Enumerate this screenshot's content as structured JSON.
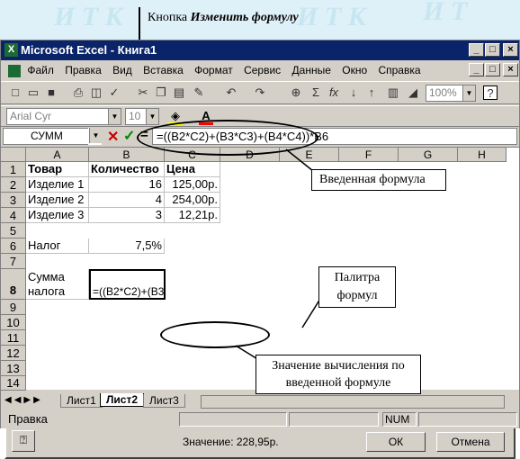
{
  "annotation_top": {
    "prefix": "Кнопка ",
    "bold": "Изменить формулу"
  },
  "window": {
    "title": "Microsoft Excel - Книга1"
  },
  "menu": [
    "Файл",
    "Правка",
    "Вид",
    "Вставка",
    "Формат",
    "Сервис",
    "Данные",
    "Окно",
    "Справка"
  ],
  "toolbar": {
    "zoom": "100%",
    "font": "Arial Cyr",
    "size": "10"
  },
  "formula_bar": {
    "name_box": "СУММ",
    "eq": "=",
    "formula": "=((B2*C2)+(B3*C3)+(B4*C4))*B6"
  },
  "columns": [
    "A",
    "B",
    "C",
    "D",
    "E",
    "F",
    "G",
    "H"
  ],
  "rows": [
    "1",
    "2",
    "3",
    "4",
    "5",
    "6",
    "7",
    "8",
    "9",
    "10",
    "11",
    "12",
    "13",
    "14"
  ],
  "cells": {
    "A1": "Товар",
    "B1": "Количество",
    "C1": "Цена",
    "A2": "Изделие 1",
    "B2": "16",
    "C2": "125,00р.",
    "A3": "Изделие 2",
    "B3": "4",
    "C3": "254,00р.",
    "A4": "Изделие 3",
    "B4": "3",
    "C4": "12,21р.",
    "A6": "Налог",
    "B6": "7,5%",
    "A8a": "Сумма",
    "A8b": "налога",
    "B8": "=((B2*C2)+(B3"
  },
  "dialog": {
    "value": "Значение: 228,95р.",
    "ok": "ОК",
    "cancel": "Отмена"
  },
  "sheets": [
    "Лист1",
    "Лист2",
    "Лист3"
  ],
  "status": {
    "mode": "Правка",
    "num": "NUM"
  },
  "callouts": {
    "entered": "Введенная формула",
    "palette1": "Палитра",
    "palette2": "формул",
    "result1": "Значение вычисления по",
    "result2": "введенной формуле"
  }
}
